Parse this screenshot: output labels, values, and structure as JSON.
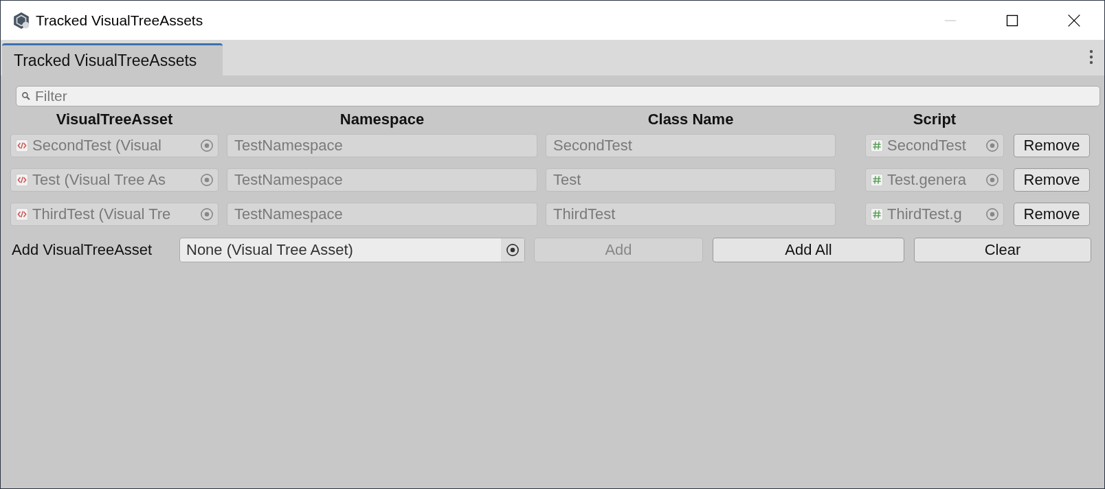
{
  "window": {
    "title": "Tracked VisualTreeAssets"
  },
  "tabs": [
    {
      "label": "Tracked VisualTreeAssets",
      "selected": true
    }
  ],
  "filter": {
    "placeholder": "Filter"
  },
  "columns": [
    "VisualTreeAsset",
    "Namespace",
    "Class Name",
    "Script"
  ],
  "rows": [
    {
      "asset": "SecondTest (Visual",
      "namespace": "TestNamespace",
      "class_name": "SecondTest",
      "script": "SecondTest",
      "disabled": true,
      "button": "Remove"
    },
    {
      "asset": "Test (Visual Tree As",
      "namespace": "TestNamespace",
      "class_name": "Test",
      "script": "Test.genera",
      "disabled": true,
      "button": "Remove"
    },
    {
      "asset": "ThirdTest (Visual Tre",
      "namespace": "TestNamespace",
      "class_name": "ThirdTest",
      "script": "ThirdTest.g",
      "disabled": true,
      "button": "Remove"
    }
  ],
  "add_row": {
    "label": "Add VisualTreeAsset",
    "value": "None (Visual Tree Asset)",
    "buttons": [
      {
        "label": "Add",
        "disabled": true
      },
      {
        "label": "Add All",
        "disabled": false
      },
      {
        "label": "Clear",
        "disabled": false
      }
    ]
  }
}
